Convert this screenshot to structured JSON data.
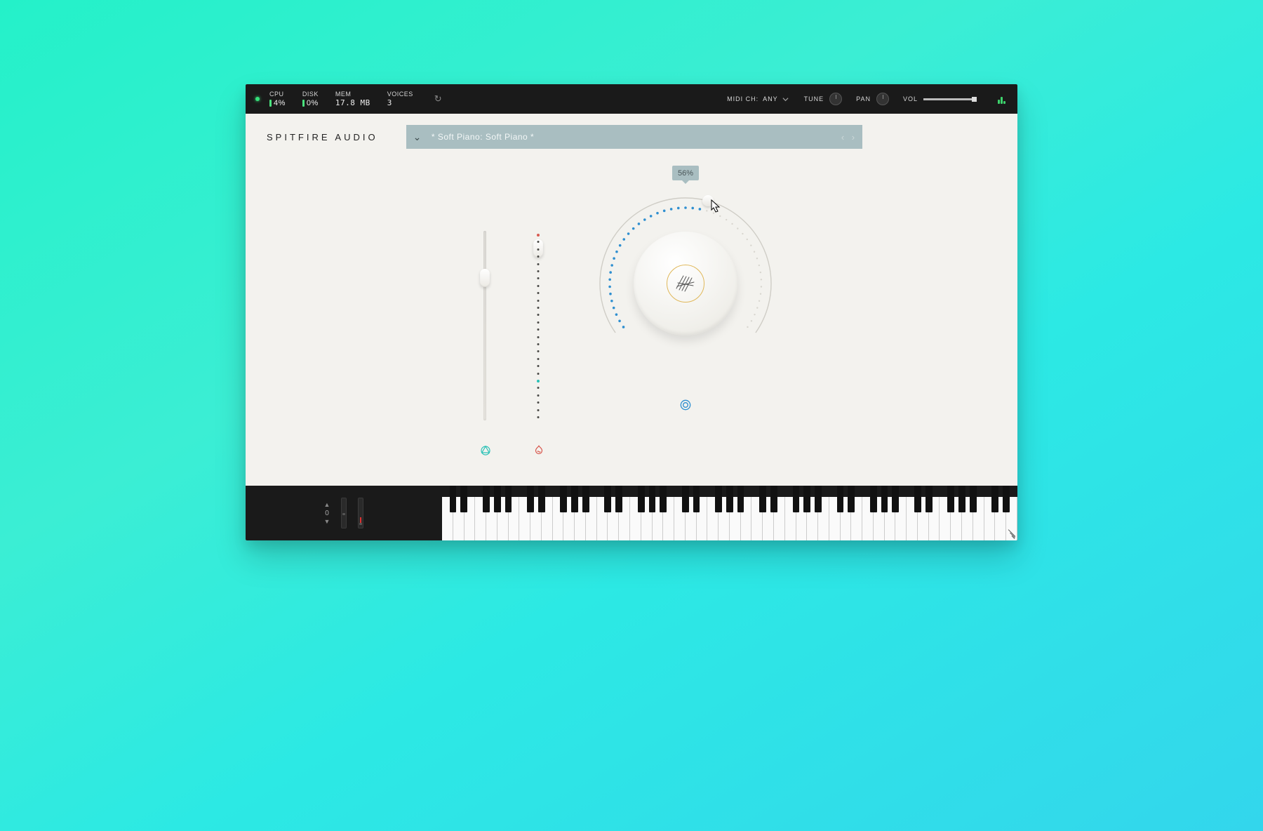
{
  "topbar": {
    "cpu": {
      "label": "CPU",
      "value": "4%"
    },
    "disk": {
      "label": "DISK",
      "value": "0%"
    },
    "mem": {
      "label": "MEM",
      "value": "17.8 MB"
    },
    "voices": {
      "label": "VOICES",
      "value": "3"
    },
    "midi": {
      "label": "MIDI CH:",
      "value": "ANY"
    },
    "tune": {
      "label": "TUNE"
    },
    "pan": {
      "label": "PAN"
    },
    "vol": {
      "label": "VOL"
    }
  },
  "brand": "SPITFIRE AUDIO",
  "preset": {
    "name": "* Soft Piano: Soft Piano *"
  },
  "knob": {
    "percent_label": "56%",
    "percent": 56
  },
  "sliders": {
    "slider1": {
      "pos": 0.78
    },
    "slider2": {
      "pos": 0.05
    }
  },
  "keyboard": {
    "octave": "0"
  },
  "colors": {
    "accent_teal": "#2ac1b6",
    "accent_red": "#d85a50",
    "accent_blue": "#2f8fd0"
  }
}
